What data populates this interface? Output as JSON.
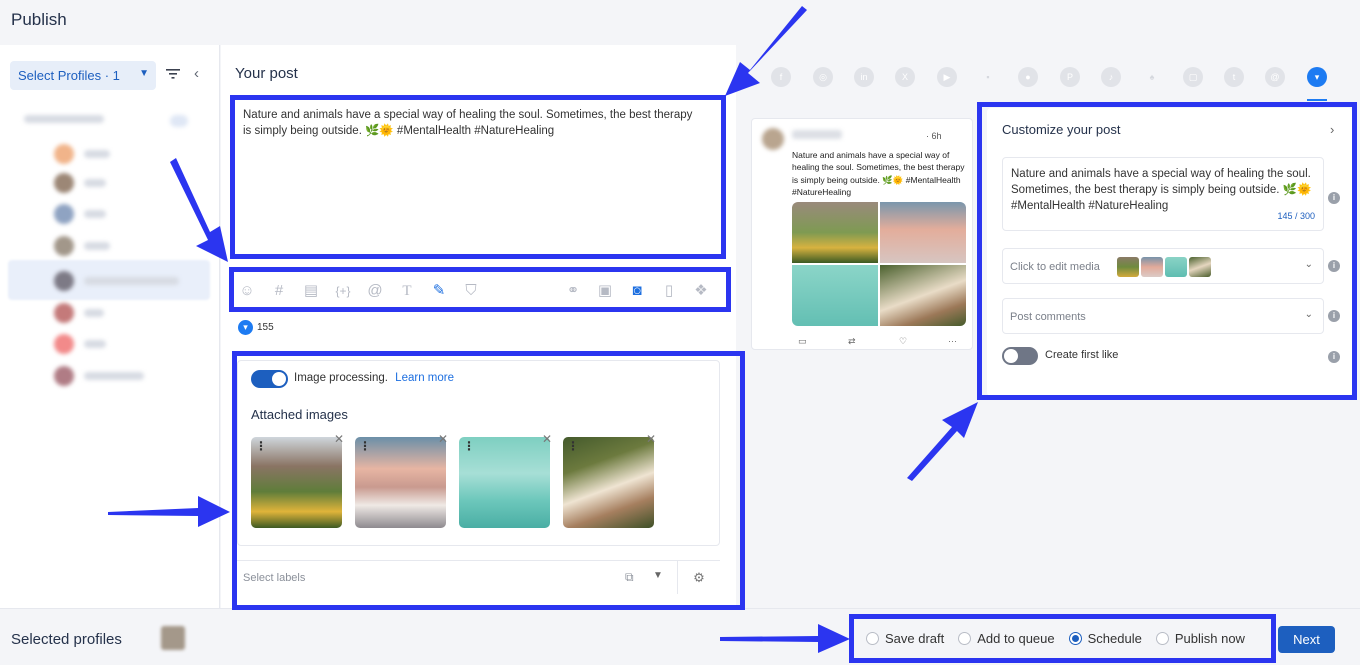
{
  "header": {
    "title": "Publish"
  },
  "sidebar": {
    "select_profiles_label": "Select Profiles · 1"
  },
  "composer": {
    "heading": "Your post",
    "text": "Nature and animals have a special way of healing the soul. Sometimes, the best therapy is simply being outside. 🌿🌞 #MentalHealth #NatureHealing",
    "toolbar_icons": [
      "emoji-icon",
      "hashtag-icon",
      "snippet-icon",
      "variable-icon",
      "mention-icon",
      "text-format-icon",
      "magic-wand-icon",
      "shield-icon",
      "link-icon",
      "video-icon",
      "camera-icon",
      "document-icon",
      "dropbox-icon"
    ],
    "char_count": "155",
    "image_processing_label": "Image processing.",
    "learn_more_label": "Learn more",
    "attached_images_label": "Attached images",
    "labels_placeholder": "Select labels"
  },
  "networks": [
    "facebook",
    "instagram",
    "linkedin",
    "x",
    "youtube",
    "google-business",
    "reddit",
    "pinterest",
    "tiktok",
    "snapchat",
    "telegram",
    "tumblr",
    "threads",
    "bluesky"
  ],
  "preview": {
    "time": "· 6h",
    "text": "Nature and animals have a special way of healing the soul. Sometimes, the best therapy is simply being outside. 🌿🌞 #MentalHealth #NatureHealing"
  },
  "customize": {
    "title": "Customize your post",
    "text": "Nature and animals have a special way of healing the soul. Sometimes, the best therapy is simply being outside. 🌿🌞 #MentalHealth #NatureHealing",
    "count": "145 / 300",
    "edit_media_label": "Click to edit media",
    "post_comments_label": "Post comments",
    "first_like_label": "Create first like"
  },
  "footer": {
    "selected_profiles_label": "Selected profiles",
    "options": [
      "Save draft",
      "Add to queue",
      "Schedule",
      "Publish now"
    ],
    "selected_option": "Schedule",
    "next_label": "Next"
  },
  "colors": {
    "accent": "#1d5fbf",
    "highlight": "#2b35f0",
    "bluesky": "#1d7bf2"
  }
}
